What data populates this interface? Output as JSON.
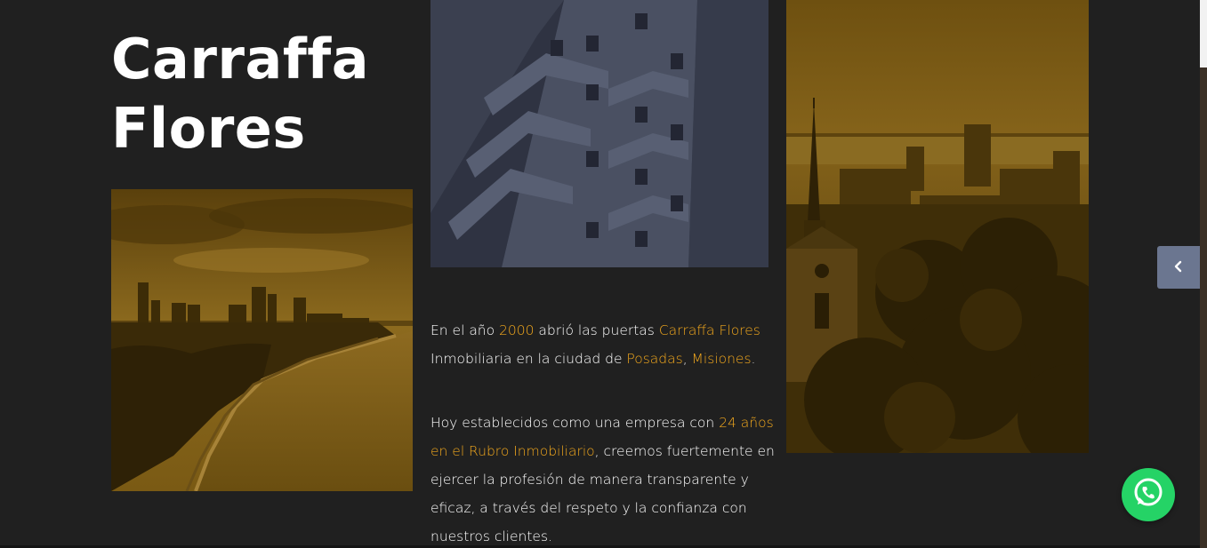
{
  "brand": {
    "title_line1": "Carraffa",
    "title_line2": "Flores"
  },
  "intro": {
    "p1": [
      {
        "text": "En el año ",
        "highlight": false
      },
      {
        "text": "2000",
        "highlight": true
      },
      {
        "text": " abrió las puertas ",
        "highlight": false
      },
      {
        "text": "Carraffa Flores",
        "highlight": true
      },
      {
        "text": " Inmobiliaria en la ciudad de ",
        "highlight": false
      },
      {
        "text": "Posadas",
        "highlight": true
      },
      {
        "text": ", ",
        "highlight": false
      },
      {
        "text": "Misiones",
        "highlight": true
      },
      {
        "text": ".",
        "highlight": false
      }
    ],
    "p2": [
      {
        "text": "Hoy establecidos como una empresa con ",
        "highlight": false
      },
      {
        "text": "24 años en el Rubro Inmobiliario",
        "highlight": true
      },
      {
        "text": ", creemos fuertemente en ejercer la profesión de manera transparente y eficaz, a través del respeto y la confianza con nuestros clientes.",
        "highlight": false
      }
    ]
  },
  "icons": {
    "prev": "chevron-left-icon",
    "whatsapp": "whatsapp-icon"
  },
  "colors": {
    "background": "#202020",
    "accent": "#f2a81d",
    "photo_tint_gold": "#8a6414",
    "photo_tint_slate": "#3a3f4f",
    "nav_button": "#6b7690",
    "whatsapp": "#25d366"
  }
}
